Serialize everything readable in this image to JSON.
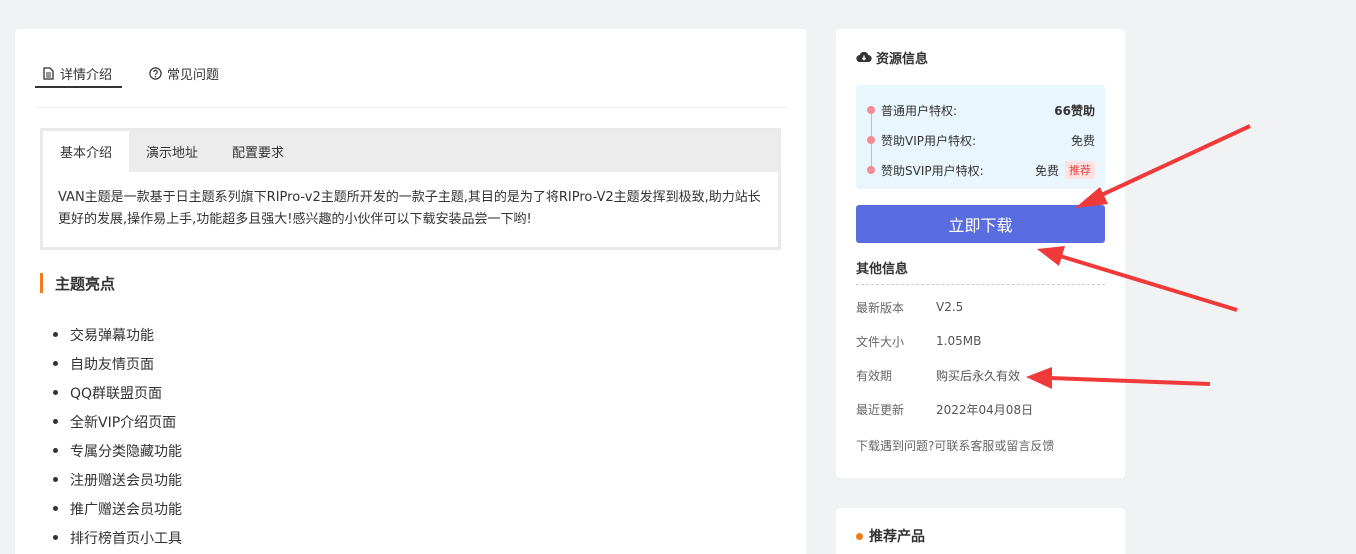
{
  "content": {
    "tabs": [
      {
        "label": "详情介绍",
        "icon": "document-icon"
      },
      {
        "label": "常见问题",
        "icon": "question-circle-icon"
      }
    ],
    "info_tabs": [
      "基本介绍",
      "演示地址",
      "配置要求"
    ],
    "intro_text": "VAN主题是一款基于日主题系列旗下RIPro-v2主题所开发的一款子主题,其目的是为了将RIPro-V2主题发挥到极致,助力站长更好的发展,操作易上手,功能超多且强大!感兴趣的小伙伴可以下载安装品尝一下哟!",
    "section_title": "主题亮点",
    "features": [
      "交易弹幕功能",
      "自助友情页面",
      "QQ群联盟页面",
      "全新VIP介绍页面",
      "专属分类隐藏功能",
      "注册赠送会员功能",
      "推广赠送会员功能",
      "排行榜首页小工具"
    ]
  },
  "sidebar": {
    "resource_title": "资源信息",
    "privileges": [
      {
        "label": "普通用户特权:",
        "value": "66赞助"
      },
      {
        "label": "赞助VIP用户特权:",
        "value": "免费"
      },
      {
        "label": "赞助SVIP用户特权:",
        "value": "免费",
        "tag": "推荐"
      }
    ],
    "download_label": "立即下载",
    "other_title": "其他信息",
    "meta": [
      {
        "label": "最新版本",
        "value": "V2.5"
      },
      {
        "label": "文件大小",
        "value": "1.05MB"
      },
      {
        "label": "有效期",
        "value": "购买后永久有效"
      },
      {
        "label": "最近更新",
        "value": "2022年04月08日"
      }
    ],
    "help_text": "下载遇到问题?可联系客服或留言反馈",
    "recommend_title": "推荐产品"
  },
  "colors": {
    "accent_button": "#5a6de0",
    "section_bar": "#f07c1b",
    "annotation_arrow": "#f03a3a"
  }
}
